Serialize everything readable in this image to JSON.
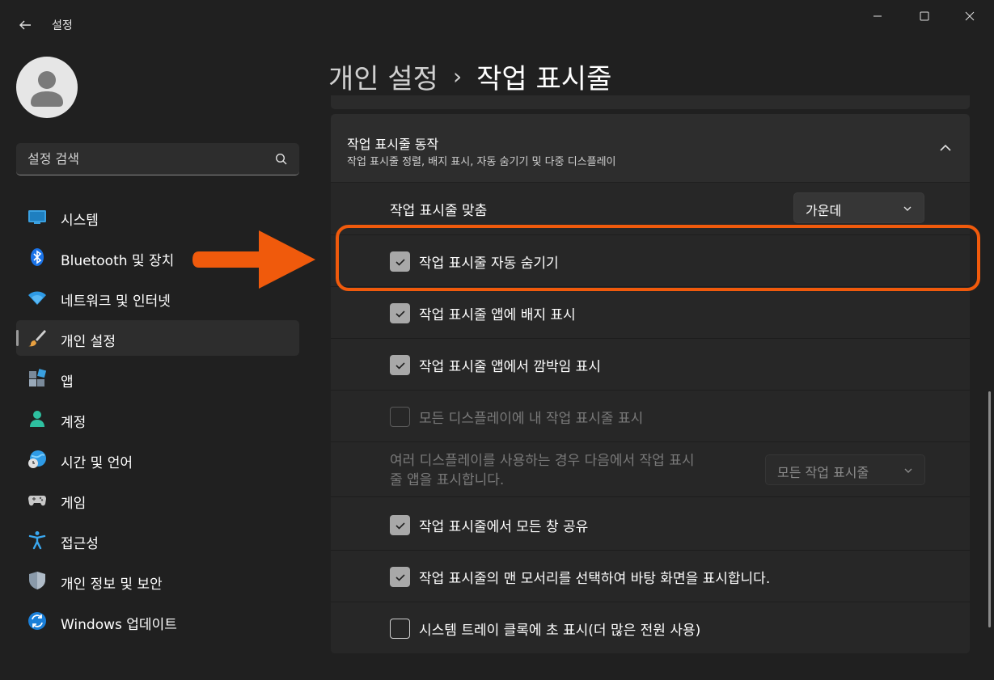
{
  "window": {
    "title": "설정",
    "back_icon": "back-arrow-icon",
    "controls": [
      "minimize-icon",
      "maximize-icon",
      "close-icon"
    ]
  },
  "search": {
    "placeholder": "설정 검색"
  },
  "sidebar": {
    "items": [
      {
        "label": "시스템",
        "icon": "system-icon"
      },
      {
        "label": "Bluetooth 및 장치",
        "icon": "bluetooth-icon"
      },
      {
        "label": "네트워크 및 인터넷",
        "icon": "wifi-icon"
      },
      {
        "label": "개인 설정",
        "icon": "brush-icon",
        "active": true
      },
      {
        "label": "앱",
        "icon": "apps-icon"
      },
      {
        "label": "계정",
        "icon": "account-icon"
      },
      {
        "label": "시간 및 언어",
        "icon": "globe-clock-icon"
      },
      {
        "label": "게임",
        "icon": "gamepad-icon"
      },
      {
        "label": "접근성",
        "icon": "accessibility-icon"
      },
      {
        "label": "개인 정보 및 보안",
        "icon": "shield-icon"
      },
      {
        "label": "Windows 업데이트",
        "icon": "update-icon"
      }
    ]
  },
  "breadcrumb": {
    "parent": "개인 설정",
    "separator": "›",
    "current": "작업 표시줄"
  },
  "section": {
    "title": "작업 표시줄 동작",
    "subtitle": "작업 표시줄 정렬, 배지 표시, 자동 숨기기 및 다중 디스플레이",
    "expanded": true
  },
  "settings": {
    "alignment": {
      "label": "작업 표시줄 맞춤",
      "value": "가운데"
    },
    "auto_hide": {
      "label": "작업 표시줄 자동 숨기기",
      "checked": true
    },
    "badges": {
      "label": "작업 표시줄 앱에 배지 표시",
      "checked": true
    },
    "flashing": {
      "label": "작업 표시줄 앱에서 깜박임 표시",
      "checked": true
    },
    "all_displays": {
      "label": "모든 디스플레이에 내 작업 표시줄 표시",
      "checked": false,
      "disabled": true
    },
    "multi_display": {
      "label_line1": "여러 디스플레이를 사용하는 경우 다음에서 작업 표시",
      "label_line2": "줄 앱을 표시합니다.",
      "value": "모든 작업 표시줄",
      "disabled": true
    },
    "share_window": {
      "label": "작업 표시줄에서 모든 창 공유",
      "checked": true
    },
    "show_desktop": {
      "label": "작업 표시줄의 맨 모서리를 선택하여 바탕 화면을 표시합니다.",
      "checked": true
    },
    "seconds_clock": {
      "label": "시스템 트레이 클록에 초 표시(더 많은 전원 사용)",
      "checked": false
    }
  },
  "colors": {
    "background": "#202020",
    "card": "#2d2d2d",
    "annotation": "#f05a0c"
  }
}
